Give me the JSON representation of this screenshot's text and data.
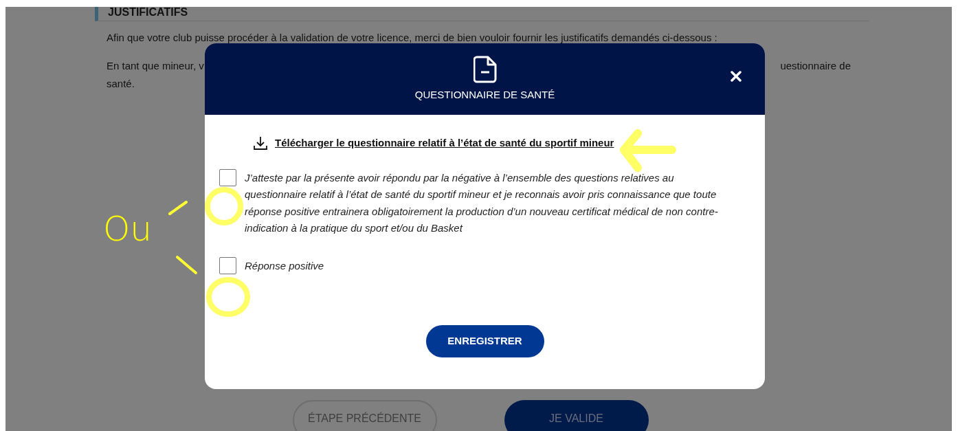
{
  "page": {
    "section_title": "JUSTIFICATIFS",
    "intro": "Afin que votre club puisse procéder à la validation de votre licence, merci de bien vouloir fournir les justificatifs demandés ci-dessous :",
    "minor_text_start": "En tant que mineur, v",
    "minor_text_end": "uestionnaire de",
    "minor_text_next_line": "santé."
  },
  "footer_buttons": [
    {
      "label": "ÉTAPE PRÉCÉDENTE",
      "kind": "outline"
    },
    {
      "label": "JE VALIDE",
      "kind": "primary"
    }
  ],
  "modal": {
    "title": "QUESTIONNAIRE DE SANTÉ",
    "download_link": "Télécharger le questionnaire relatif à l’état de santé du sportif mineur",
    "options": [
      {
        "label": "J’atteste par la présente avoir répondu par la négative à l’ensemble des questions relatives au questionnaire relatif à l’état de santé du sportif mineur et je reconnais avoir pris connaissance que toute réponse positive entrainera obligatoirement la production d’un nouveau certificat médical de non contre-indication à la pratique du sport et/ou du Basket",
        "checked": false
      },
      {
        "label": "Réponse positive",
        "checked": false
      }
    ],
    "submit": "ENREGISTRER"
  },
  "annotation": {
    "text": "Ou"
  }
}
